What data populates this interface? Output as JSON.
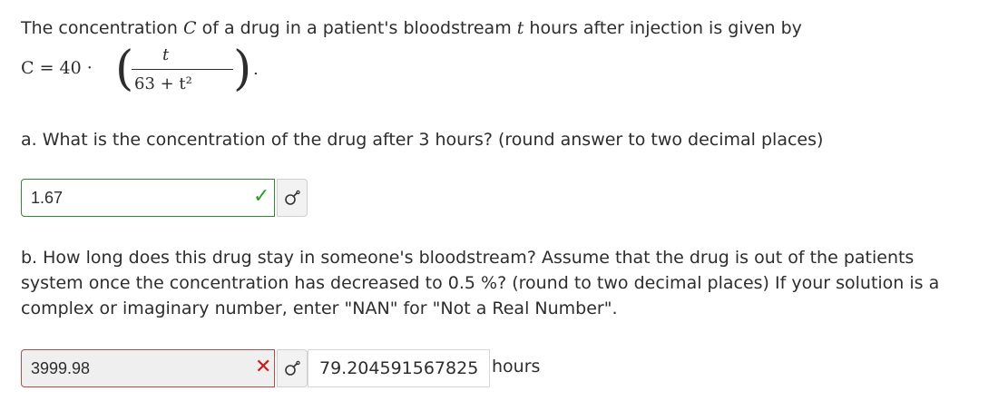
{
  "question": {
    "intro_prefix": "The concentration ",
    "var_c": "C",
    "intro_mid": " of a drug in a patient's bloodstream ",
    "var_t": "t",
    "intro_suffix": " hours after injection is given by",
    "formula": {
      "lhs": "C = 40 ·",
      "numerator": "t",
      "denominator": "63 + t²",
      "trailing": "."
    }
  },
  "part_a": {
    "prompt": "a. What is the concentration of the drug after 3 hours? (round answer to two decimal places)",
    "answer_value": "1.67",
    "status": "correct"
  },
  "part_b": {
    "prompt_line1": "b. How long does this drug stay in someone's bloodstream? Assume that the drug is out of the patients",
    "prompt_line2": "system once the concentration has decreased to 0.5 %? (round to two decimal places) If your solution is a",
    "prompt_line3": "complex or imaginary number, enter \"NAN\" for \"Not a Real Number\".",
    "answer_value": "3999.98",
    "status": "incorrect",
    "preview_value": "79.204591567825",
    "unit": "hours"
  },
  "colors": {
    "correct": "#2e9a2e",
    "incorrect": "#cc1a1a"
  },
  "icons": {
    "correct": "checkmark-icon",
    "incorrect": "cross-icon",
    "preview": "preview-eye-icon"
  }
}
